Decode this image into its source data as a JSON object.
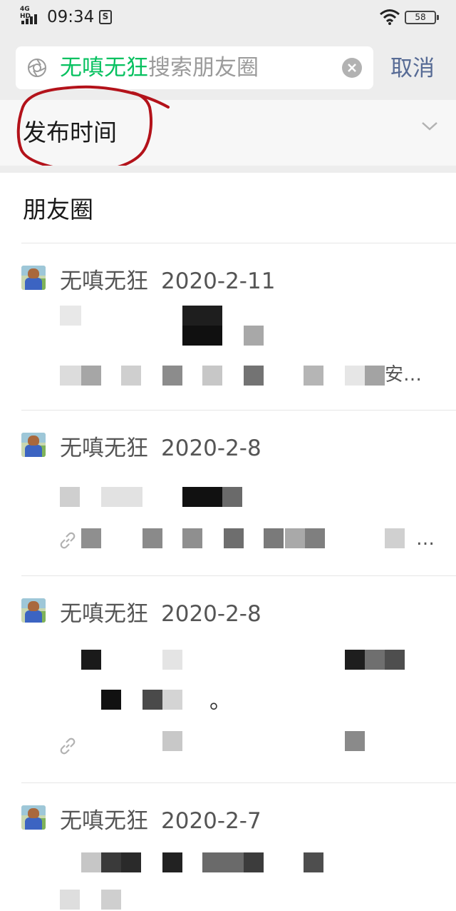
{
  "status_bar": {
    "network": "4G HD",
    "time": "09:34",
    "notification_icon": "app-notification-icon",
    "battery": "58"
  },
  "search": {
    "keyword": "无嗔无狂",
    "placeholder": "搜索朋友圈",
    "cancel_label": "取消",
    "icons": [
      "camera-lens-icon",
      "clear-icon"
    ]
  },
  "filter": {
    "label": "发布时间",
    "chevron_icon": "chevron-down-icon",
    "annotation": "red hand-drawn circle around filter label",
    "annotation_color": "#b3121a"
  },
  "section": {
    "title": "朋友圈"
  },
  "results": [
    {
      "author": "无嗔无狂",
      "date": "2020-2-11",
      "snippet_visible_fragment": "安…"
    },
    {
      "author": "无嗔无狂",
      "date": "2020-2-8",
      "snippet_visible_fragment": "…"
    },
    {
      "author": "无嗔无狂",
      "date": "2020-2-8",
      "snippet_visible_fragment": "。"
    },
    {
      "author": "无嗔无狂",
      "date": "2020-2-7",
      "snippet_visible_fragment": ""
    }
  ],
  "colors": {
    "keyword_green": "#07c160",
    "link_blue": "#576b95",
    "background_gray": "#ededed",
    "annotation_red": "#b3121a"
  }
}
